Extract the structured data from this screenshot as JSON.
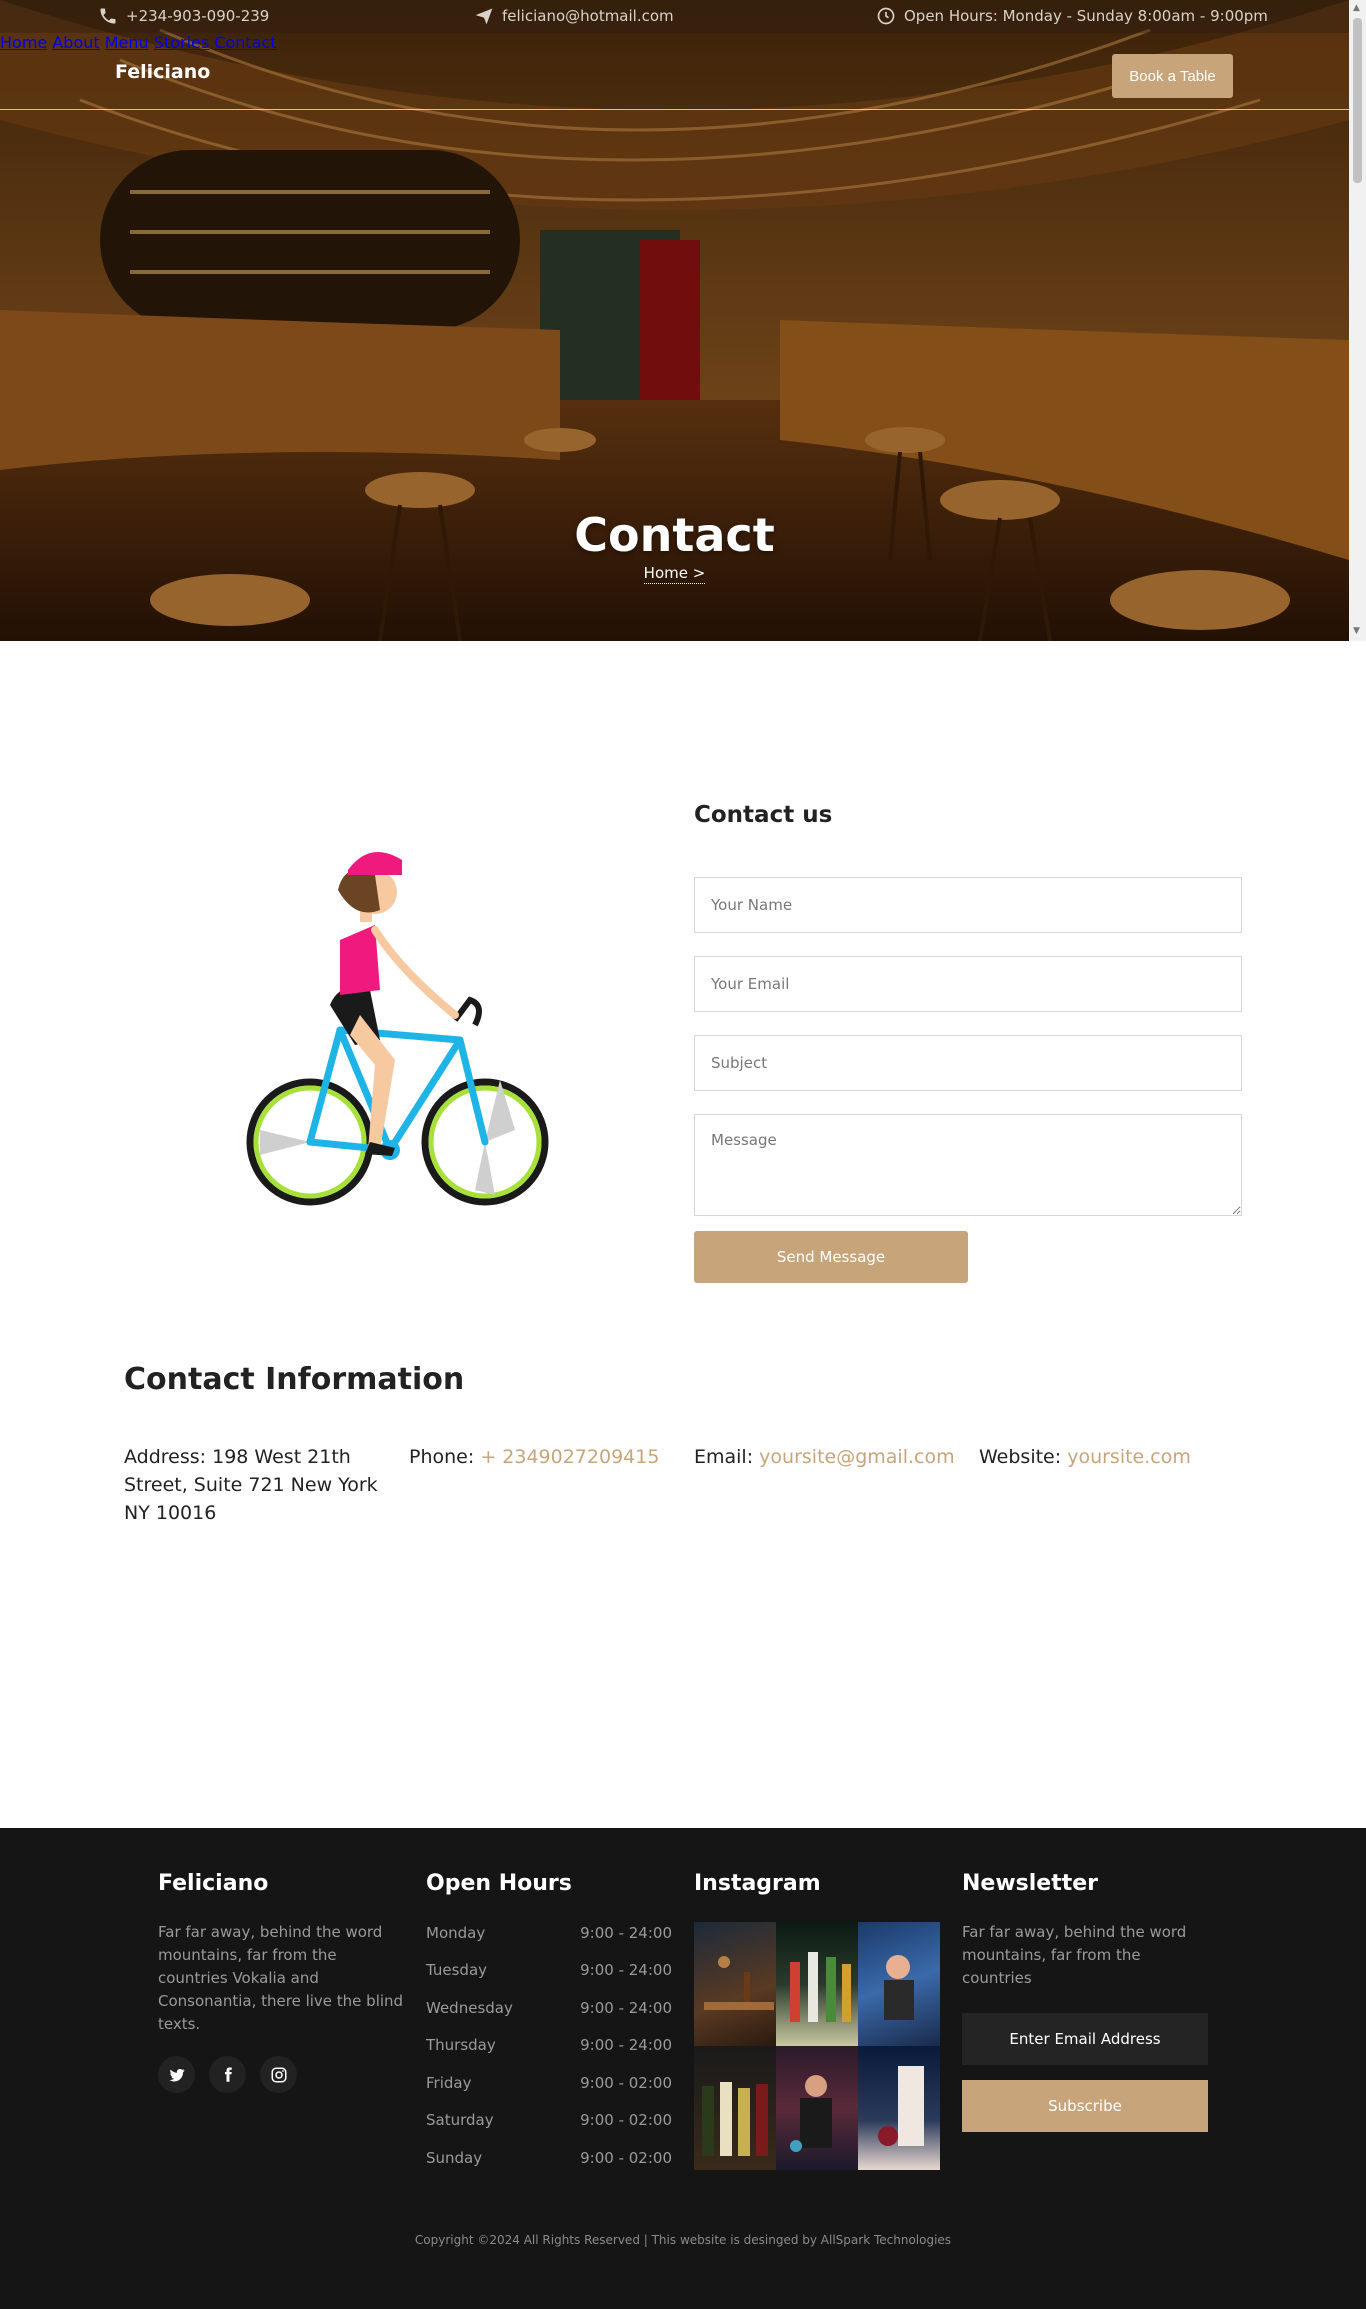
{
  "topbar": {
    "phone": "+234-903-090-239",
    "email": "feliciano@hotmail.com",
    "hours": "Open Hours: Monday - Sunday 8:00am - 9:00pm"
  },
  "nav": {
    "brand": "Feliciano",
    "items": [
      "Home",
      "About",
      "Menu",
      "Stories",
      "Contact"
    ],
    "cta": "Book a Table"
  },
  "hero": {
    "title": "Contact",
    "breadcrumb": "Home >"
  },
  "form": {
    "title": "Contact us",
    "name_placeholder": "Your Name",
    "email_placeholder": "Your Email",
    "subject_placeholder": "Subject",
    "message_placeholder": "Message",
    "send_label": "Send Message"
  },
  "info": {
    "title": "Contact Information",
    "address_label": "Address:",
    "address_value": "198 West 21th Street, Suite 721 New York NY 10016",
    "phone_label": "Phone:",
    "phone_value": "+ 2349027209415",
    "email_label": "Email:",
    "email_value": "yoursite@gmail.com",
    "website_label": "Website:",
    "website_value": "yoursite.com"
  },
  "footer": {
    "brand": "Feliciano",
    "about": "Far far away, behind the word mountains, far from the countries Vokalia and Consonantia, there live the blind texts.",
    "hours_title": "Open Hours",
    "hours": [
      {
        "day": "Monday",
        "time": "9:00 - 24:00"
      },
      {
        "day": "Tuesday",
        "time": "9:00 - 24:00"
      },
      {
        "day": "Wednesday",
        "time": "9:00 - 24:00"
      },
      {
        "day": "Thursday",
        "time": "9:00 - 24:00"
      },
      {
        "day": "Friday",
        "time": "9:00 - 02:00"
      },
      {
        "day": "Saturday",
        "time": "9:00 - 02:00"
      },
      {
        "day": "Sunday",
        "time": "9:00 - 02:00"
      }
    ],
    "instagram_title": "Instagram",
    "newsletter_title": "Newsletter",
    "newsletter_text": "Far far away, behind the word mountains, far from the countries",
    "newsletter_placeholder": "Enter Email Address",
    "subscribe_label": "Subscribe",
    "copyright": "Copyright ©2024   All Rights Reserved | This website is desinged by AllSpark Technologies"
  },
  "colors": {
    "accent": "#c8a47a",
    "footer_bg": "#151515"
  }
}
